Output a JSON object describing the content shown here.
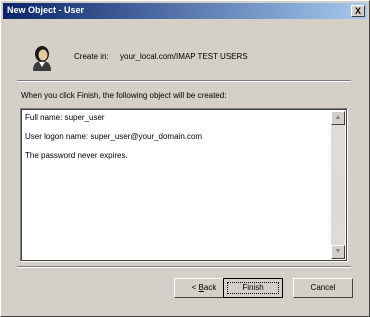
{
  "window": {
    "title": "New Object - User",
    "close_glyph": "X"
  },
  "header": {
    "icon": "user-icon",
    "create_in_label": "Create in:",
    "create_in_path": "your_local.com/IMAP TEST USERS"
  },
  "main": {
    "instruction": "When you click Finish, the following object will be created:",
    "summary_lines": [
      "Full name: super_user",
      "User logon name: super_user@your_domain.com",
      "The password never expires."
    ]
  },
  "buttons": {
    "back_prefix": "< ",
    "back_accel": "B",
    "back_rest": "ack",
    "finish": "Finish",
    "cancel": "Cancel"
  },
  "colors": {
    "titlebar_start": "#0a246a",
    "titlebar_end": "#a6caf0",
    "dialog_bg": "#d4d0c8"
  }
}
